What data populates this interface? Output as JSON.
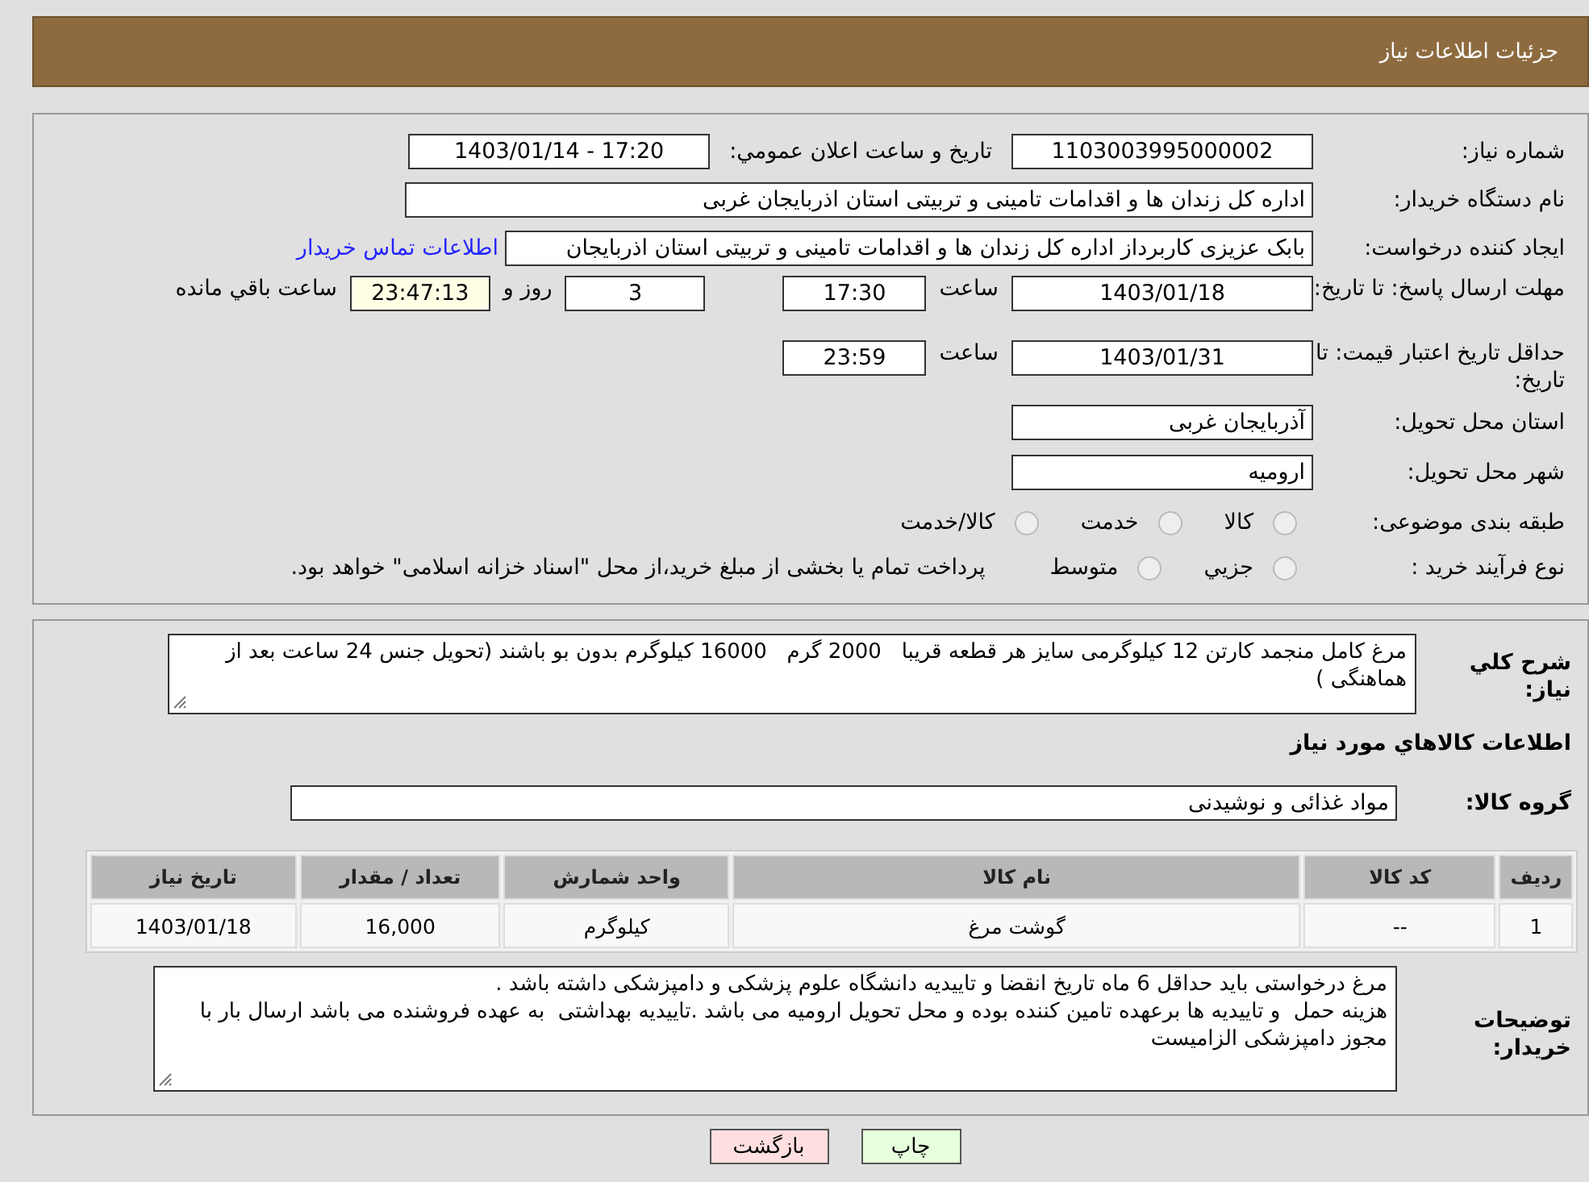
{
  "header": {
    "title": "جزئیات اطلاعات نیاز"
  },
  "info": {
    "need_number": {
      "label": "شماره نیاز:",
      "value": "1103003995000002"
    },
    "announce": {
      "label": "تاریخ و ساعت اعلان عمومي:",
      "value": "1403/01/14 - 17:20"
    },
    "buyer": {
      "label": "نام دستگاه خریدار:",
      "value": "اداره کل زندان ها و اقدامات تامینی و تربیتی استان اذربایجان غربی"
    },
    "creator": {
      "label": "ایجاد کننده درخواست:",
      "value": "بابک عزیزی کاربرداز اداره کل زندان ها و اقدامات تامینی و تربیتی استان اذربایجان",
      "link": "اطلاعات تماس خریدار"
    },
    "deadline": {
      "label": "مهلت ارسال پاسخ: تا تاریخ:",
      "date": "1403/01/18",
      "time_label": "ساعت",
      "time": "17:30",
      "days": "3",
      "days_label": "روز و",
      "remaining": "23:47:13",
      "remaining_label": "ساعت باقي مانده"
    },
    "validity": {
      "label": "حداقل تاریخ اعتبار قیمت: تا تاریخ:",
      "date": "1403/01/31",
      "time_label": "ساعت",
      "time": "23:59"
    },
    "province": {
      "label": "استان محل تحویل:",
      "value": "آذربایجان غربی"
    },
    "city": {
      "label": "شهر محل تحویل:",
      "value": "ارومیه"
    },
    "category": {
      "label": "طبقه بندی موضوعی:",
      "options": [
        {
          "label": "کالا",
          "selected": false
        },
        {
          "label": "خدمت",
          "selected": false
        },
        {
          "label": "کالا/خدمت",
          "selected": false
        }
      ]
    },
    "process": {
      "label": "نوع فرآیند خرید :",
      "options": [
        {
          "label": "جزيي",
          "selected": false
        },
        {
          "label": "متوسط",
          "selected": false
        }
      ],
      "note": "پرداخت تمام یا بخشی از مبلغ خرید،از محل \"اسناد خزانه اسلامی\" خواهد بود."
    }
  },
  "details": {
    "description": {
      "label": "شرح كلي نياز:",
      "value": "مرغ کامل منجمد کارتن 12 کیلوگرمی سایز هر قطعه قریبا   2000 گرم   16000 کیلوگرم بدون بو باشند (تحویل جنس 24 ساعت بعد از هماهنگی )"
    },
    "goods_title": "اطلاعات كالاهاي مورد نياز",
    "group": {
      "label": "گروه كالا:",
      "value": "مواد غذائی و نوشیدنی"
    },
    "table": {
      "columns": [
        "رديف",
        "کد کالا",
        "نام کالا",
        "واحد شمارش",
        "تعداد / مقدار",
        "تاریخ نیاز"
      ],
      "rows": [
        [
          "1",
          "--",
          "گوشت مرغ",
          "کیلوگرم",
          "16,000",
          "1403/01/18"
        ]
      ]
    },
    "notes": {
      "label": "توضیحات خریدار:",
      "value": "مرغ درخواستی باید حداقل 6 ماه تاریخ انقضا و تاییدیه دانشگاه علوم پزشکی و دامپزشکی داشته باشد .\nهزینه حمل  و تاییدیه ها برعهده تامین کننده بوده و محل تحویل ارومیه می باشد .تاییدیه بهداشتی  به عهده فروشنده می باشد ارسال بار با مجوز دامپزشکی الزامیست"
    }
  },
  "buttons": [
    {
      "kind": "print",
      "label": "چاپ"
    },
    {
      "kind": "back",
      "label": "بازگشت"
    }
  ]
}
